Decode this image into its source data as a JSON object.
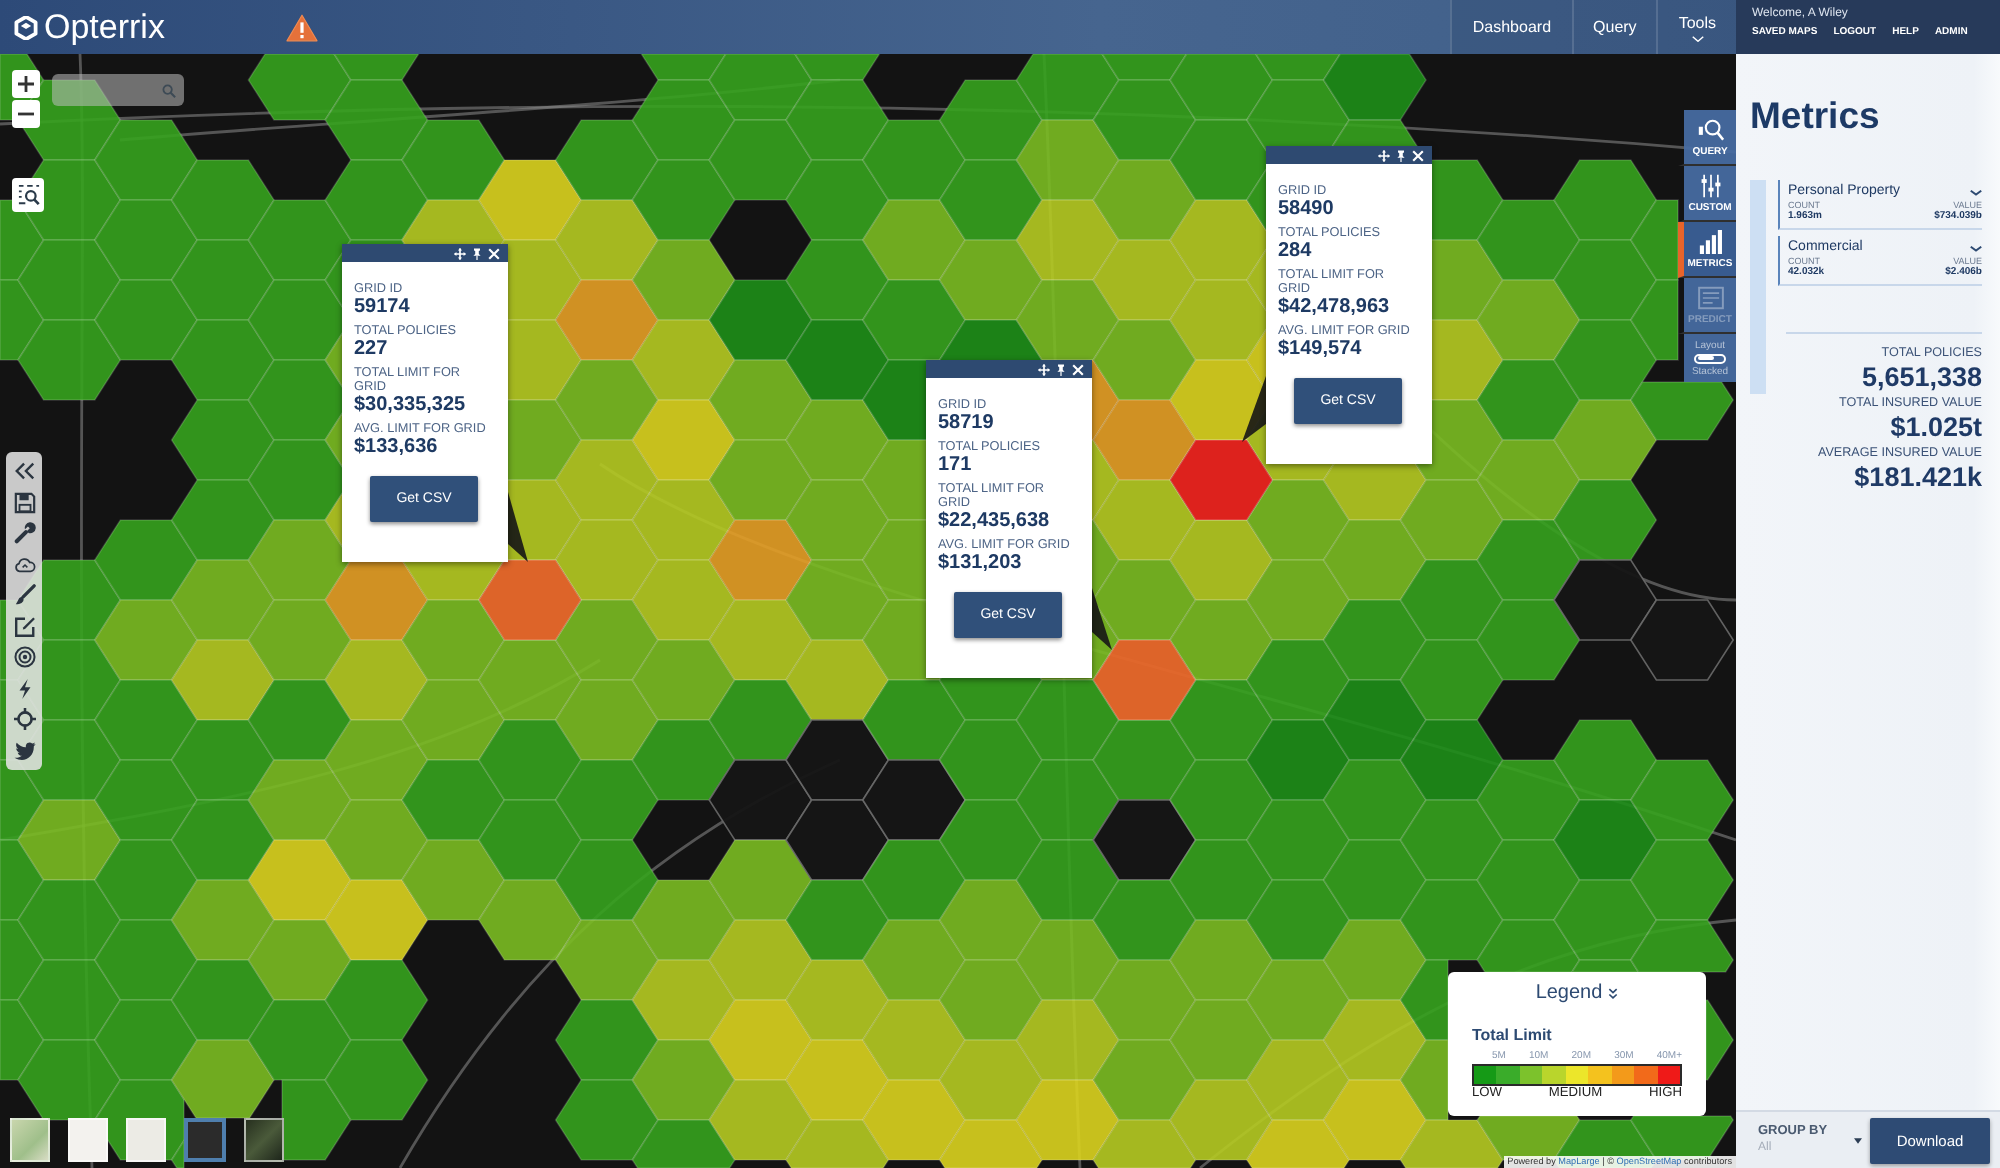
{
  "header": {
    "logo": "Opterrix",
    "nav": [
      {
        "label": "Dashboard",
        "dropdown": false
      },
      {
        "label": "Query",
        "dropdown": false
      },
      {
        "label": "Tools",
        "dropdown": true
      }
    ],
    "welcome": "Welcome, A Wiley",
    "links": [
      "SAVED MAPS",
      "LOGOUT",
      "HELP",
      "ADMIN"
    ]
  },
  "popups": [
    {
      "fields": [
        {
          "label": "GRID ID",
          "value": "59174"
        },
        {
          "label": "TOTAL POLICIES",
          "value": "227"
        },
        {
          "label": "TOTAL LIMIT FOR GRID",
          "value": "$30,335,325"
        },
        {
          "label": "AVG. LIMIT FOR GRID",
          "value": "$133,636"
        }
      ],
      "button": "Get CSV"
    },
    {
      "fields": [
        {
          "label": "GRID ID",
          "value": "58719"
        },
        {
          "label": "TOTAL POLICIES",
          "value": "171"
        },
        {
          "label": "TOTAL LIMIT FOR GRID",
          "value": "$22,435,638"
        },
        {
          "label": "AVG. LIMIT FOR GRID",
          "value": "$131,203"
        }
      ],
      "button": "Get CSV"
    },
    {
      "fields": [
        {
          "label": "GRID ID",
          "value": "58490"
        },
        {
          "label": "TOTAL POLICIES",
          "value": "284"
        },
        {
          "label": "TOTAL LIMIT FOR GRID",
          "value": "$42,478,963"
        },
        {
          "label": "AVG. LIMIT FOR GRID",
          "value": "$149,574"
        }
      ],
      "button": "Get CSV"
    }
  ],
  "side_tabs": [
    {
      "label": "QUERY",
      "kind": "query",
      "selected": false,
      "disabled": false
    },
    {
      "label": "CUSTOM",
      "kind": "custom",
      "selected": false,
      "disabled": false
    },
    {
      "label": "METRICS",
      "kind": "metrics",
      "selected": true,
      "disabled": false
    },
    {
      "label": "PREDICT",
      "kind": "predict",
      "selected": false,
      "disabled": true
    }
  ],
  "layout_toggle": {
    "label": "Layout",
    "value": "Stacked"
  },
  "legend": {
    "title": "Legend",
    "subtitle": "Total Limit",
    "ticks": [
      "5M",
      "10M",
      "20M",
      "30M",
      "40M+"
    ],
    "swatches": [
      {
        "color": "#159a16"
      },
      {
        "color": "#3aac2a"
      },
      {
        "color": "#7cc22c"
      },
      {
        "color": "#b9d52c"
      },
      {
        "color": "#ece62a"
      },
      {
        "color": "#f4c21e"
      },
      {
        "color": "#f39a1a"
      },
      {
        "color": "#f26a1a"
      },
      {
        "color": "#ef1a18"
      }
    ],
    "scale_labels": [
      "LOW",
      "MEDIUM",
      "HIGH"
    ]
  },
  "attribution": [
    {
      "kind": "text",
      "text": "Powered by "
    },
    {
      "kind": "link",
      "text": "MapLarge"
    },
    {
      "kind": "text",
      "text": " | © "
    },
    {
      "kind": "link",
      "text": "OpenStreetMap"
    },
    {
      "kind": "text",
      "text": " contributors"
    }
  ],
  "basemaps": [
    {
      "kind": "terrain",
      "selected": false
    },
    {
      "kind": "light",
      "selected": false
    },
    {
      "kind": "plain",
      "selected": false
    },
    {
      "kind": "dark",
      "selected": true
    },
    {
      "kind": "satellite",
      "selected": false
    }
  ],
  "metrics": {
    "title": "Metrics",
    "groups": [
      {
        "name": "Personal Property",
        "count_label": "COUNT",
        "count": "1.963m",
        "value_label": "VALUE",
        "value": "$734.039b"
      },
      {
        "name": "Commercial",
        "count_label": "COUNT",
        "count": "42.032k",
        "value_label": "VALUE",
        "value": "$2.406b"
      }
    ],
    "totals": [
      {
        "label": "TOTAL POLICIES",
        "value": "5,651,338"
      },
      {
        "label": "TOTAL INSURED VALUE",
        "value": "$1.025t"
      },
      {
        "label": "AVERAGE INSURED VALUE",
        "value": "$181.421k"
      }
    ]
  },
  "footer": {
    "group_by": {
      "label": "GROUP BY",
      "value": "All"
    },
    "button": "Download"
  }
}
